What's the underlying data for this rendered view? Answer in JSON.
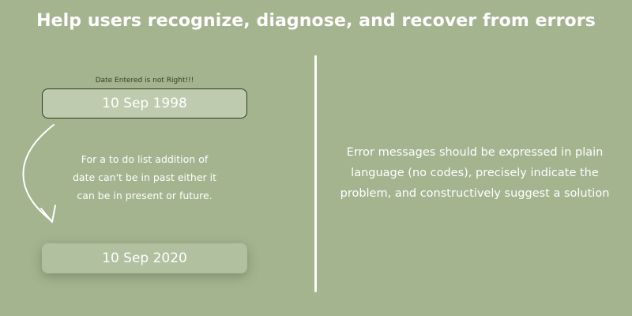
{
  "header": {
    "title": "Help users recognize, diagnose, and recover from errors"
  },
  "example": {
    "error_label": "Date Entered is not Right!!!",
    "wrong_date": "10 Sep 1998",
    "hint": "For a to do list addition of date can't be in past either it can be in present or future.",
    "correct_date": "10 Sep 2020"
  },
  "principle": {
    "text": "Error messages should be expressed in plain language (no codes), precisely indicate the problem, and constructively suggest a solution"
  },
  "colors": {
    "background": "#a3b48f",
    "text": "#ffffff",
    "error_border": "#2e3a24"
  }
}
